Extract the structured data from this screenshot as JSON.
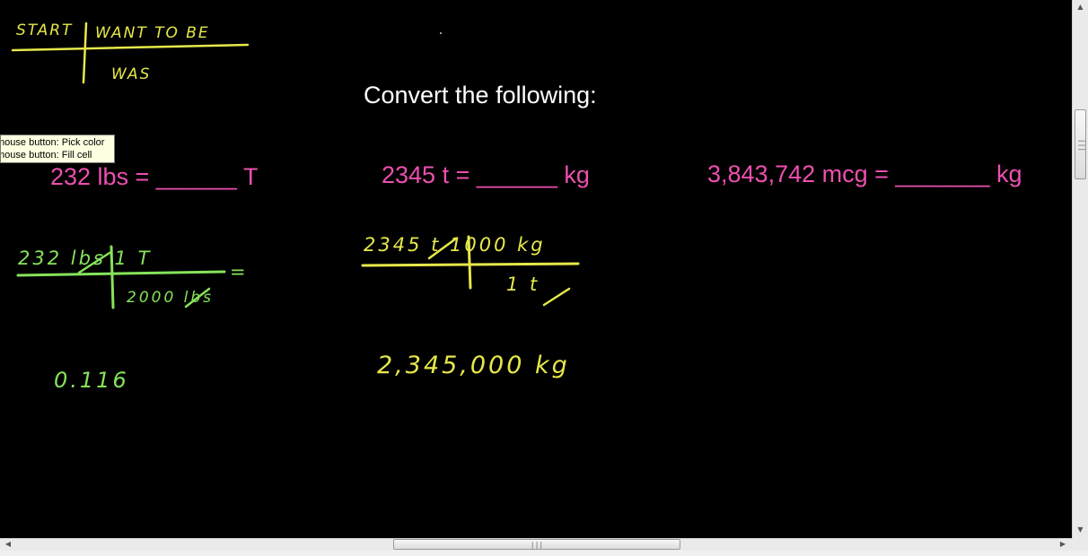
{
  "heading": "Convert the following:",
  "method": {
    "start": "START",
    "want": "WANT  TO  BE",
    "was": "WAS"
  },
  "problems": [
    {
      "typed": "232 lbs = ______ T",
      "work_top": "232 lbs   1  T",
      "work_equals": "=",
      "work_bottom": "2000 lbs",
      "answer": "0.116"
    },
    {
      "typed": "2345 t = ______ kg",
      "work_top": "2345 t   1000 kg",
      "work_bottom": "1    t",
      "answer": "2,345,000 kg"
    },
    {
      "typed": "3,843,742 mcg = _______  kg"
    }
  ],
  "tooltip": {
    "line1": "mouse button: Pick color",
    "line2": "mouse button: Fill cell"
  },
  "scrollbar": {
    "grip": "|||",
    "up": "▲",
    "down": "▼",
    "left": "◀",
    "right": "▶"
  },
  "colors": {
    "yellow": "#e6e84a",
    "green": "#86e35b",
    "pink": "#ec4fb0",
    "background": "#000000"
  }
}
